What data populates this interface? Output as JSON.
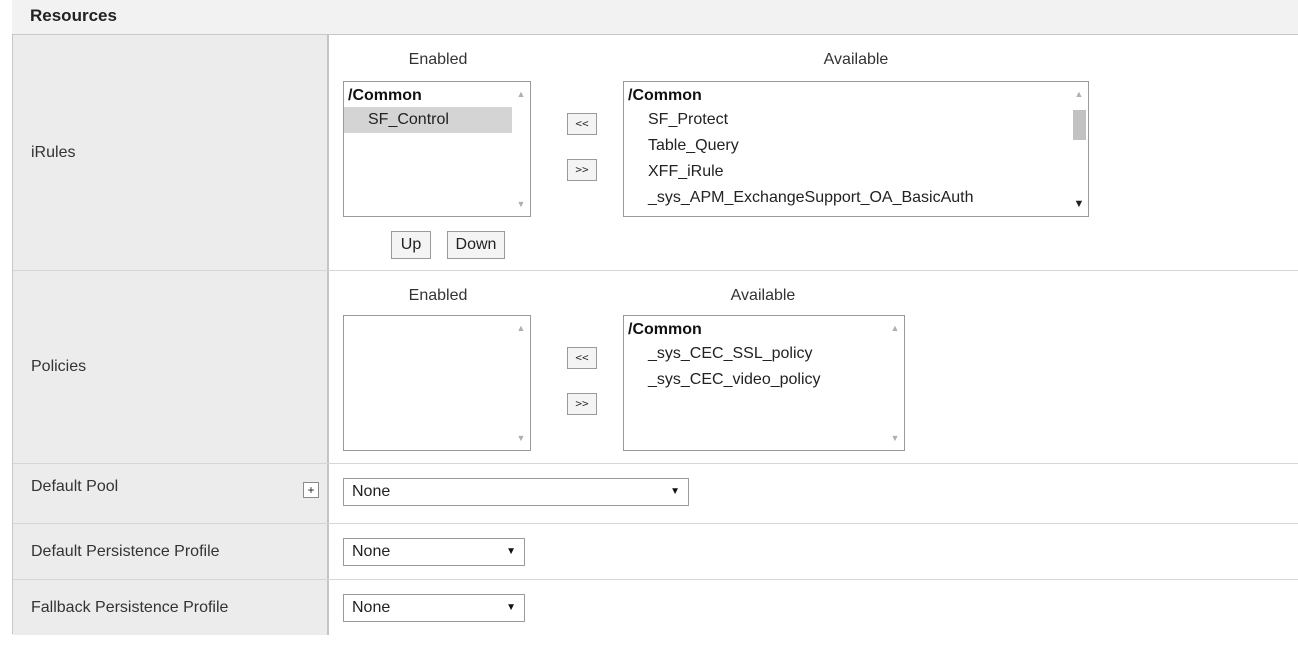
{
  "section": {
    "title": "Resources"
  },
  "irules": {
    "label": "iRules",
    "enabled_title": "Enabled",
    "available_title": "Available",
    "enabled_list": {
      "group": "/Common",
      "items": [
        "SF_Control"
      ],
      "selected_index": 0
    },
    "available_list": {
      "group": "/Common",
      "items": [
        "SF_Protect",
        "Table_Query",
        "XFF_iRule",
        "_sys_APM_ExchangeSupport_OA_BasicAuth"
      ]
    },
    "move_left_label": "<<",
    "move_right_label": ">>",
    "up_label": "Up",
    "down_label": "Down"
  },
  "policies": {
    "label": "Policies",
    "enabled_title": "Enabled",
    "available_title": "Available",
    "available_list": {
      "group": "/Common",
      "items": [
        "_sys_CEC_SSL_policy",
        "_sys_CEC_video_policy"
      ]
    },
    "move_left_label": "<<",
    "move_right_label": ">>"
  },
  "default_pool": {
    "label": "Default Pool",
    "add_label": "+",
    "value": "None"
  },
  "default_persistence": {
    "label": "Default Persistence Profile",
    "value": "None"
  },
  "fallback_persistence": {
    "label": "Fallback Persistence Profile",
    "value": "None"
  },
  "icons": {
    "scroll_up": "triangle-up",
    "scroll_down": "triangle-down",
    "dropdown": "triangle-down"
  }
}
